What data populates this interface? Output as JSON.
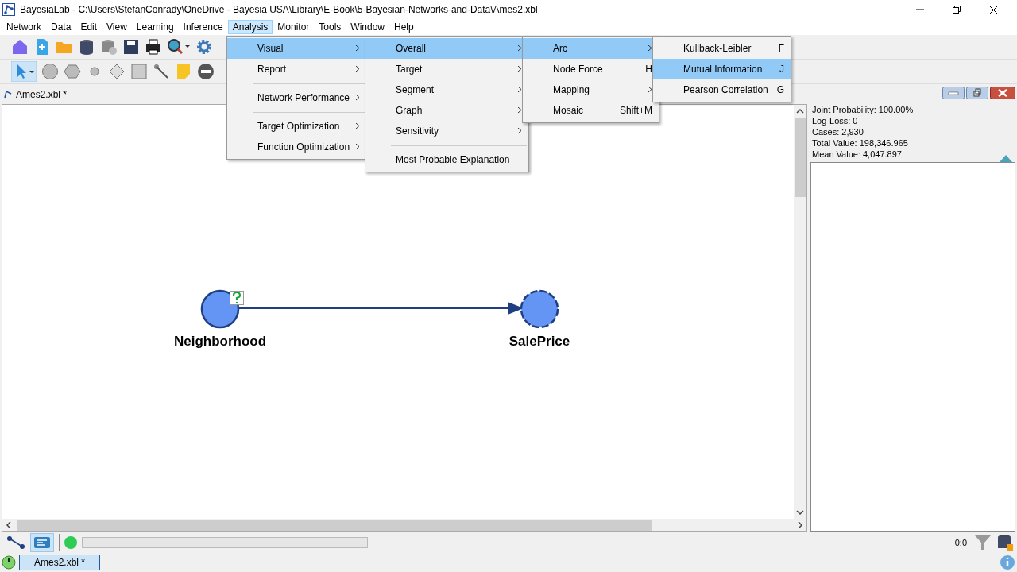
{
  "window": {
    "title": "BayesiaLab - C:\\Users\\StefanConrady\\OneDrive - Bayesia USA\\Library\\E-Book\\5-Bayesian-Networks-and-Data\\Ames2.xbl"
  },
  "menubar": [
    {
      "label": "Network",
      "selected": false
    },
    {
      "label": "Data",
      "selected": false
    },
    {
      "label": "Edit",
      "selected": false
    },
    {
      "label": "View",
      "selected": false
    },
    {
      "label": "Learning",
      "selected": false
    },
    {
      "label": "Inference",
      "selected": false
    },
    {
      "label": "Analysis",
      "selected": true
    },
    {
      "label": "Monitor",
      "selected": false
    },
    {
      "label": "Tools",
      "selected": false
    },
    {
      "label": "Window",
      "selected": false
    },
    {
      "label": "Help",
      "selected": false
    }
  ],
  "menus": [
    [
      {
        "kind": "item",
        "label": "Visual",
        "submenu": true,
        "selected": true
      },
      {
        "kind": "item",
        "label": "Report",
        "submenu": true,
        "selected": false
      },
      {
        "kind": "separator"
      },
      {
        "kind": "item",
        "label": "Network Performance",
        "submenu": true,
        "selected": false
      },
      {
        "kind": "separator"
      },
      {
        "kind": "item",
        "label": "Target Optimization",
        "submenu": true,
        "selected": false
      },
      {
        "kind": "item",
        "label": "Function Optimization",
        "submenu": true,
        "selected": false
      }
    ],
    [
      {
        "kind": "item",
        "label": "Overall",
        "submenu": true,
        "selected": true
      },
      {
        "kind": "item",
        "label": "Target",
        "submenu": true,
        "selected": false
      },
      {
        "kind": "item",
        "label": "Segment",
        "submenu": true,
        "selected": false
      },
      {
        "kind": "item",
        "label": "Graph",
        "submenu": true,
        "selected": false
      },
      {
        "kind": "item",
        "label": "Sensitivity",
        "submenu": true,
        "selected": false
      },
      {
        "kind": "separator"
      },
      {
        "kind": "item",
        "label": "Most Probable Explanation",
        "submenu": false,
        "selected": false
      }
    ],
    [
      {
        "kind": "item",
        "label": "Arc",
        "submenu": true,
        "selected": true
      },
      {
        "kind": "item",
        "label": "Node Force",
        "shortcut": "H",
        "submenu": false,
        "selected": false
      },
      {
        "kind": "item",
        "label": "Mapping",
        "submenu": true,
        "selected": false
      },
      {
        "kind": "item",
        "label": "Mosaic",
        "shortcut": "Shift+M",
        "submenu": false,
        "selected": false
      }
    ],
    [
      {
        "kind": "item",
        "label": "Kullback-Leibler",
        "shortcut": "F",
        "submenu": false,
        "selected": false
      },
      {
        "kind": "item",
        "label": "Mutual Information",
        "shortcut": "J",
        "submenu": false,
        "selected": true
      },
      {
        "kind": "item",
        "label": "Pearson Correlation",
        "shortcut": "G",
        "submenu": false,
        "selected": false
      }
    ]
  ],
  "document_tab": {
    "label": "Ames2.xbl *"
  },
  "nodes": [
    {
      "name": "Neighborhood",
      "kind": "evidence"
    },
    {
      "name": "SalePrice",
      "kind": "target"
    }
  ],
  "stats": [
    "Joint Probability: 100.00%",
    "Log-Loss: 0",
    "Cases: 2,930",
    "Total Value: 198,346.965",
    "Mean Value: 4,047.897"
  ],
  "status": {
    "counter": "0:0"
  },
  "taskbar": {
    "label": "Ames2.xbl *"
  }
}
